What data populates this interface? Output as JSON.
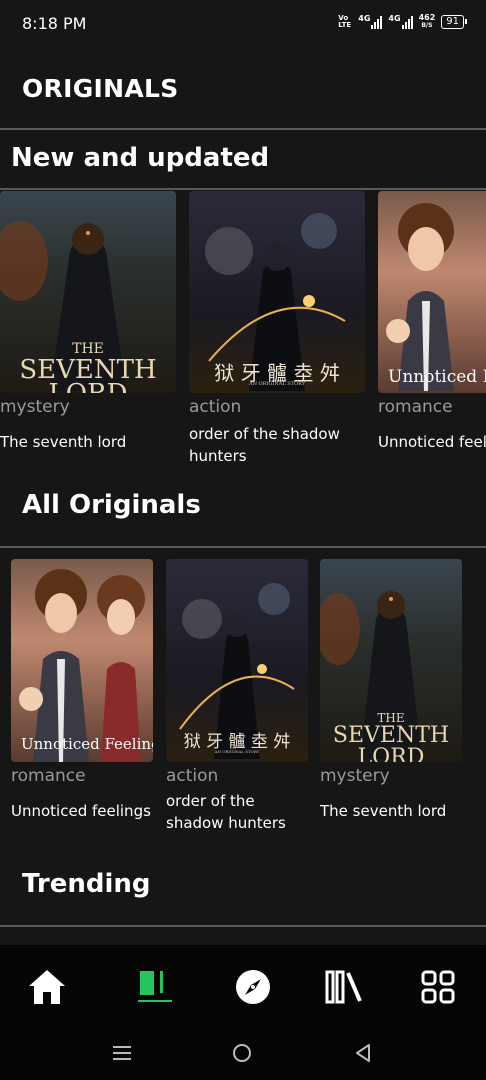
{
  "status_bar": {
    "time": "8:18 PM",
    "volte": "Vo LTE",
    "net1": "4G",
    "net2": "4G",
    "speed_value": "462",
    "speed_unit": "B/S",
    "battery": "91"
  },
  "header": {
    "title": "ORIGINALS"
  },
  "sections": {
    "new_and_updated": {
      "title": "New and updated",
      "items": [
        {
          "genre": "mystery",
          "title": "The seventh lord",
          "cover_text_1": "THE",
          "cover_text_2": "SEVENTH",
          "cover_text_3": "LORD"
        },
        {
          "genre": "action",
          "title": "order of the shadow hunters",
          "cover_text_1": "狱 牙 髗 坴 舛",
          "cover_text_2": "AN ORIGINAL STORY"
        },
        {
          "genre": "romance",
          "title": "Unnoticed feel",
          "cover_text_1": "Unnoticed Feelings"
        }
      ]
    },
    "all_originals": {
      "title": "All Originals",
      "items": [
        {
          "genre": "romance",
          "title": "Unnoticed feelings",
          "cover_text_1": "Unnoticed Feelings"
        },
        {
          "genre": "action",
          "title": "order of the shadow hunters",
          "cover_text_1": "狱 牙 髗 坴 舛",
          "cover_text_2": "AN ORIGINAL STORY"
        },
        {
          "genre": "mystery",
          "title": "The seventh lord",
          "cover_text_1": "THE",
          "cover_text_2": "SEVENTH",
          "cover_text_3": "LORD"
        }
      ]
    },
    "trending": {
      "title": "Trending"
    }
  },
  "bottom_nav": {
    "items": [
      {
        "icon": "home-icon",
        "active": false
      },
      {
        "icon": "originals-icon",
        "active": true
      },
      {
        "icon": "compass-icon",
        "active": false
      },
      {
        "icon": "library-icon",
        "active": false
      },
      {
        "icon": "grid-icon",
        "active": false
      }
    ],
    "accent": "#22c55e"
  },
  "system_nav": {
    "icons": [
      "menu-icon",
      "home-circle-icon",
      "back-icon"
    ]
  }
}
